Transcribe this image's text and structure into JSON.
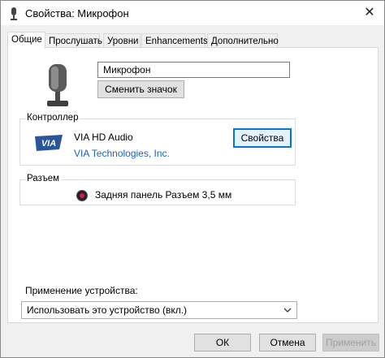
{
  "window": {
    "title": "Свойства: Микрофон",
    "close": "✕"
  },
  "tabs": [
    {
      "label": "Общие",
      "active": true
    },
    {
      "label": "Прослушать"
    },
    {
      "label": "Уровни"
    },
    {
      "label": "Enhancements"
    },
    {
      "label": "Дополнительно"
    }
  ],
  "general": {
    "device_name": "Микрофон",
    "change_icon_label": "Сменить значок",
    "controller": {
      "group_label": "Контроллер",
      "name": "VIA HD Audio",
      "manufacturer": "VIA Technologies, Inc.",
      "properties_label": "Свойства",
      "logo_text": "VIA"
    },
    "jack": {
      "group_label": "Разъем",
      "text": "Задняя панель Разъем 3,5 мм"
    },
    "usage": {
      "label": "Применение устройства:",
      "value": "Использовать это устройство (вкл.)"
    }
  },
  "buttons": {
    "ok": "ОК",
    "cancel": "Отмена",
    "apply": "Применить"
  },
  "colors": {
    "accent": "#0078d7",
    "link": "#1e62b8",
    "jack": "#d51a4a"
  }
}
